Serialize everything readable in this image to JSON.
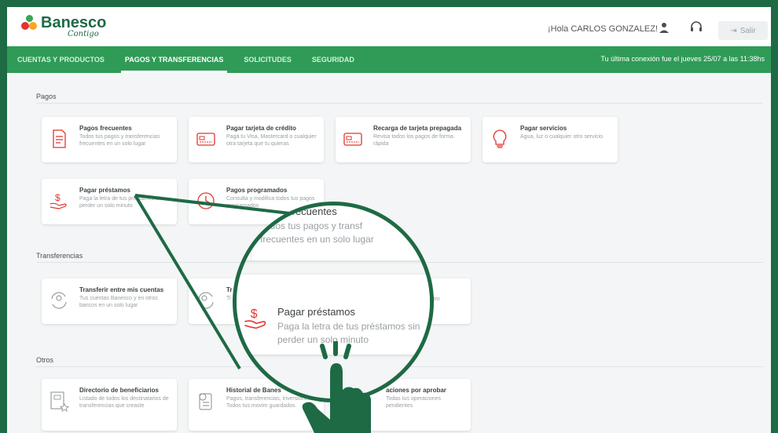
{
  "header": {
    "logo_name": "Banesco",
    "logo_sub": "Contigo",
    "greeting": "¡Hola CARLOS GONZALEZ!",
    "logout_label": "Salir"
  },
  "nav": {
    "items": [
      {
        "label": "CUENTAS Y PRODUCTOS",
        "active": false
      },
      {
        "label": "PAGOS Y TRANSFERENCIAS",
        "active": true
      },
      {
        "label": "SOLICITUDES",
        "active": false
      },
      {
        "label": "SEGURIDAD",
        "active": false
      }
    ],
    "last_connection": "Tu última conexión fue el jueves 25/07 a las 11:38hs"
  },
  "sections": {
    "pagos": "Pagos",
    "transferencias": "Transferencias",
    "otros": "Otros"
  },
  "cards": {
    "pagos_frecuentes": {
      "title": "Pagos frecuentes",
      "desc": "Todos tus pagos y transferencias frecuentes en un solo lugar"
    },
    "pagar_tarjeta": {
      "title": "Pagar tarjeta de crédito",
      "desc": "Pagá tu Visa, Mastercard o cualquier otra tarjeta que tu quieras"
    },
    "recarga_tarjeta": {
      "title": "Recarga de tarjeta prepagada",
      "desc": "Revisa todos los pagos de forma rápida"
    },
    "pagar_servicios": {
      "title": "Pagar servicios",
      "desc": "Agua, luz o cualquier otro servicio"
    },
    "pagar_prestamos": {
      "title": "Pagar préstamos",
      "desc": "Paga la letra de tus préstamos sin perder un solo minuto"
    },
    "pagos_programados": {
      "title": "Pagos programados",
      "desc": "Consulta y modifica todos tus pagos programados"
    },
    "transferir_mis_cuentas": {
      "title": "Transferir entre mis cuentas",
      "desc": "Tus cuentas Banesco y en otros bancos en un solo lugar"
    },
    "transferir_terceros": {
      "title": "Tr",
      "desc": "Ti",
      "desc_tail": "ecio a otro"
    },
    "directorio": {
      "title": "Directorio de beneficiarios",
      "desc": "Listado de todos los destinatarios de transferencias que creaste"
    },
    "historial": {
      "title": "Historial de Banes",
      "desc": "Pagos, transferencias, inversiones. Todos tus movim guardados."
    },
    "operaciones": {
      "title": "aciones por aprobar",
      "desc": "Todas tus operaciones pendientes"
    }
  },
  "magnifier": {
    "top_title": "frecuentes",
    "top_desc_line1": "Todos tus pagos y transf",
    "top_desc_line2": "frecuentes en un solo lugar",
    "card_title": "Pagar préstamos",
    "card_desc_line1": "Paga la letra de tus préstamos sin",
    "card_desc_line2": "perder un solo minuto"
  },
  "colors": {
    "brand_dark": "#1e6a45",
    "nav_green": "#2f9b57",
    "accent_red": "#e3342f"
  }
}
